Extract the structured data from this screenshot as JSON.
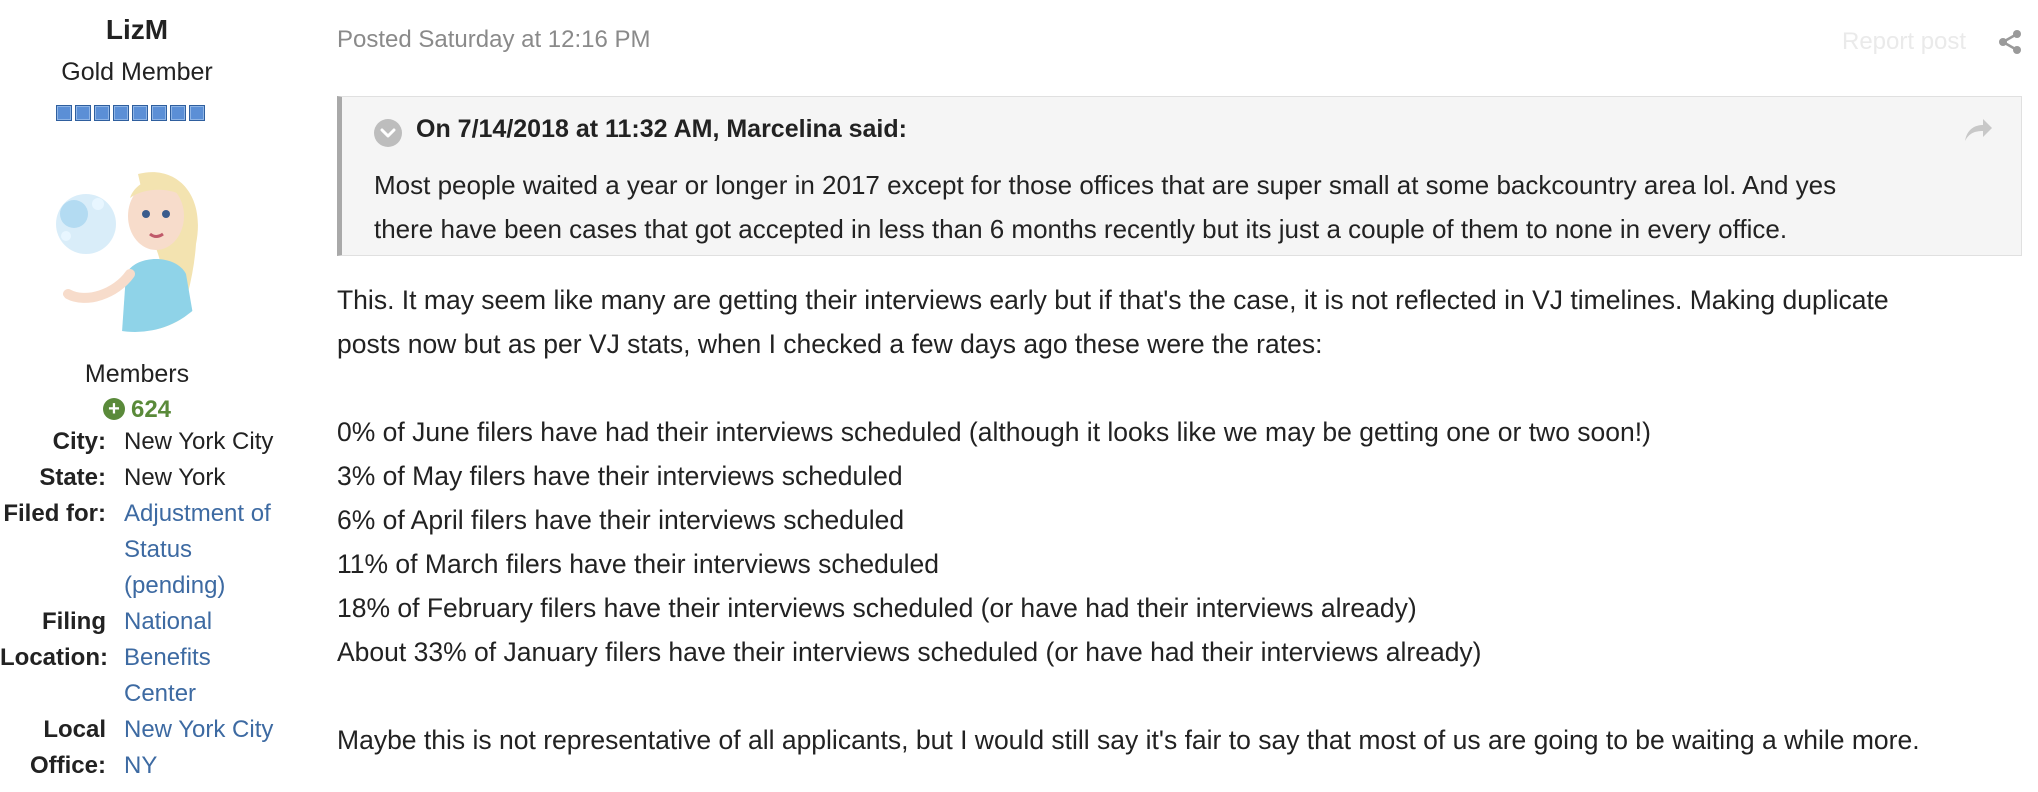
{
  "author": {
    "name": "LizM",
    "title": "Gold Member",
    "group": "Members",
    "reputation": "624",
    "rank_pips": 8,
    "fields": [
      {
        "label_lines": [
          "City:"
        ],
        "value_lines": [
          "New York City"
        ],
        "is_link": false
      },
      {
        "label_lines": [
          "State:"
        ],
        "value_lines": [
          "New York"
        ],
        "is_link": false
      },
      {
        "label_lines": [
          "Filed for:"
        ],
        "value_lines": [
          "Adjustment of",
          "Status",
          "(pending)"
        ],
        "is_link": true
      },
      {
        "label_lines": [
          "Filing",
          "Location:"
        ],
        "value_lines": [
          "National",
          "Benefits",
          "Center"
        ],
        "is_link": true
      },
      {
        "label_lines": [
          "Local",
          "Office:"
        ],
        "value_lines": [
          "New York City",
          "NY"
        ],
        "is_link": true
      }
    ]
  },
  "post": {
    "posted": "Posted Saturday at 12:16 PM",
    "report_label": "Report post",
    "quote": {
      "citation": "On 7/14/2018 at 11:32 AM, Marcelina said:",
      "lines": [
        "Most people waited a year or longer in 2017 except for those offices that are super small at some backcountry area lol. And yes",
        "there have been cases that got accepted in less than 6 months recently but its just a couple of them to none in every office."
      ]
    },
    "paragraph1": [
      "This. It may seem like many are getting their interviews early but if that's the case, it is not reflected in VJ timelines. Making duplicate",
      "posts now but as per VJ stats, when I checked a few days ago these were the rates:"
    ],
    "stats": [
      "0% of June filers have had their interviews scheduled (although it looks like we may be getting one or two soon!)",
      "3% of May filers have their interviews scheduled",
      "6% of April filers have their interviews scheduled",
      "11% of March filers have their interviews scheduled",
      "18% of February filers have their interviews scheduled (or have had their interviews already)",
      "About 33% of January filers have their interviews scheduled (or have had their interviews already)"
    ],
    "closing": "Maybe this is not representative of all applicants, but I would still say it's fair to say that most of us are going to be waiting a while more."
  },
  "colors": {
    "link": "#3d6aa2",
    "reputation": "#5a8a3a",
    "meta_text": "#8a8a8a",
    "rank_pip": "#5b8fd6"
  }
}
